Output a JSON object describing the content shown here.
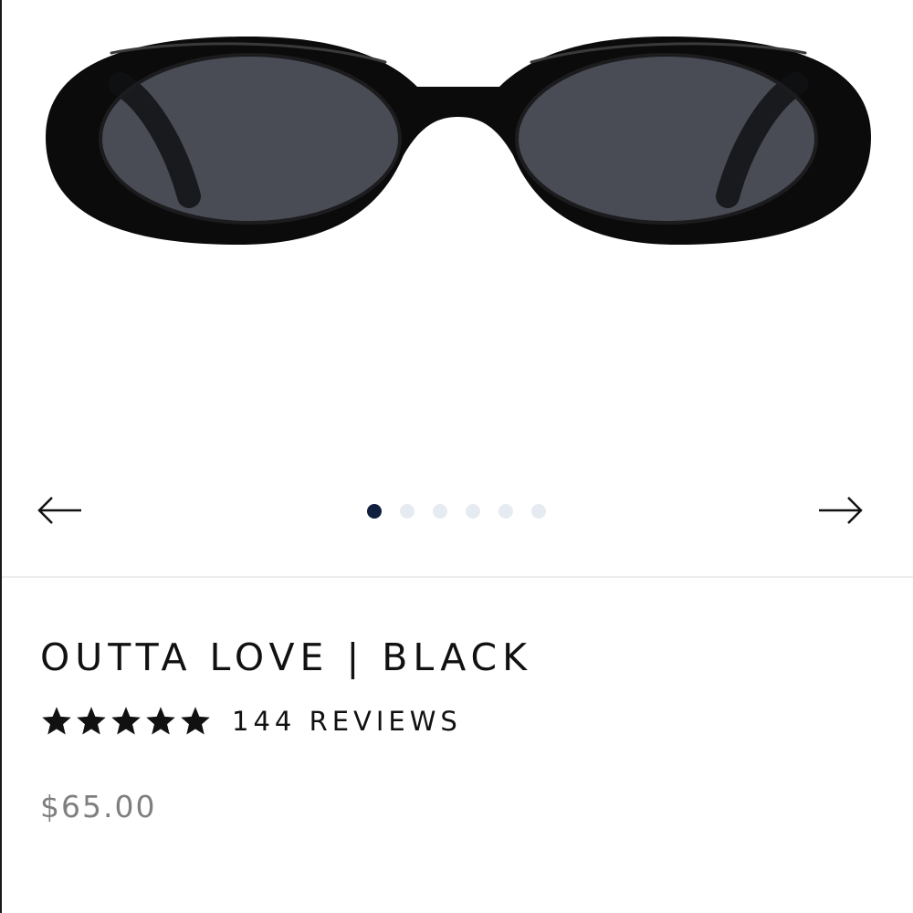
{
  "product": {
    "image_alt": "Oval black sunglasses with dark smoke lenses, front view",
    "title": "OUTTA LOVE | BLACK",
    "rating": {
      "stars": 5,
      "max": 5
    },
    "reviews_label": "144 REVIEWS",
    "price": "$65.00"
  },
  "carousel": {
    "prev_icon": "arrow-left-icon",
    "next_icon": "arrow-right-icon",
    "slide_count": 6,
    "active_index": 0
  },
  "colors": {
    "frame": "#0b0b0b",
    "lens": "#4a4c55",
    "active_dot": "#0f1f3d",
    "inactive_dot": "#e6ebf2",
    "price": "#7f7f7f"
  }
}
